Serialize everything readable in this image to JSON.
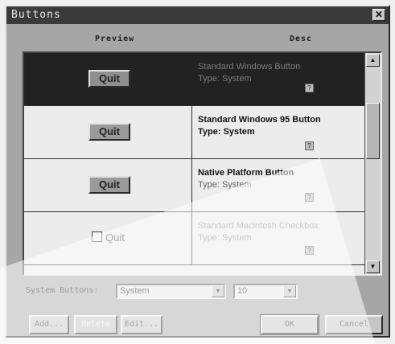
{
  "window": {
    "title": "Buttons"
  },
  "columns": {
    "preview": "Preview",
    "description": "Desc"
  },
  "rows": [
    {
      "button": "Quit",
      "line1": "Standard Windows Button",
      "line2": "Type: System"
    },
    {
      "button": "Quit",
      "line1": "Standard Windows 95 Button",
      "line2": "Type: System"
    },
    {
      "button": "Quit",
      "line1": "Native Platform Button",
      "line2": "Type: System"
    },
    {
      "button": "Quit",
      "line1": "Standard Macintosh Checkbox",
      "line2": "Type: System"
    }
  ],
  "system_buttons": {
    "label": "System Buttons:",
    "type_value": "System",
    "size_value": "10"
  },
  "actions": {
    "add": "Add...",
    "delete": "Delete",
    "edit": "Edit...",
    "ok": "OK",
    "cancel": "Cancel"
  },
  "icons": {
    "close": "close-icon",
    "help": "help-icon",
    "scroll_up": "arrow-up-icon",
    "scroll_down": "arrow-down-icon",
    "dropdown": "chevron-down-icon"
  },
  "colors": {
    "selected_row": "#222222",
    "window_face": "#a6a6a6",
    "title_bar": "#3a3a3a"
  }
}
